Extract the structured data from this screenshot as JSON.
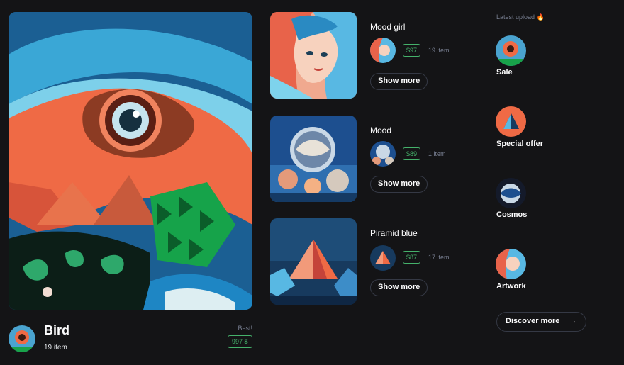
{
  "hero": {
    "title": "Bird",
    "count": "19 item",
    "badge_label": "Best!",
    "price": "997 $"
  },
  "items": [
    {
      "title": "Mood girl",
      "price": "$97",
      "count": "19 item",
      "button": "Show more"
    },
    {
      "title": "Mood",
      "price": "$89",
      "count": "1 item",
      "button": "Show more"
    },
    {
      "title": "Piramid blue",
      "price": "$87",
      "count": "17 item",
      "button": "Show more"
    }
  ],
  "latest": {
    "label": "Latest upload 🔥",
    "entries": [
      {
        "label": "Sale"
      },
      {
        "label": "Special offer"
      },
      {
        "label": "Cosmos"
      },
      {
        "label": "Artwork"
      }
    ],
    "discover": "Discover more",
    "discover_arrow": "→"
  },
  "colors": {
    "background": "#141416",
    "accent_green": "#45b26b",
    "muted": "#777e90",
    "border": "#353945"
  }
}
